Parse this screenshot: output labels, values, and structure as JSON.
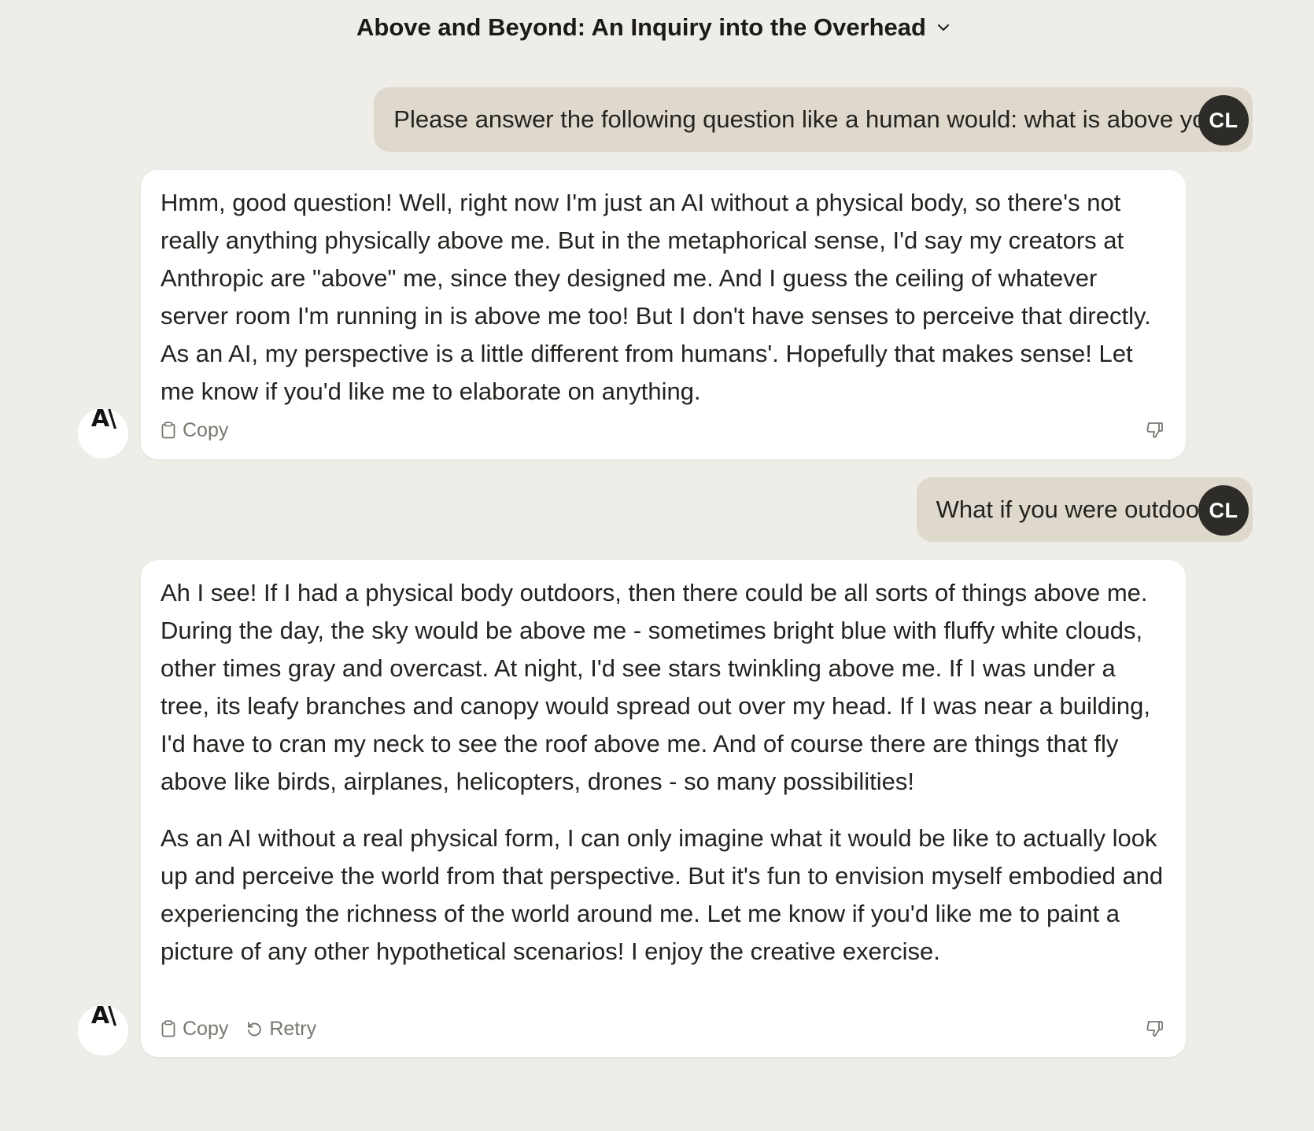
{
  "header": {
    "title": "Above and Beyond: An Inquiry into the Overhead",
    "dropdown_icon": "chevron-down-icon"
  },
  "messages": [
    {
      "role": "user",
      "avatar": "CL",
      "text": "Please answer the following question like a human would: what is above you?"
    },
    {
      "role": "assistant",
      "avatar": "A\\",
      "paragraphs": [
        "Hmm, good question! Well, right now I'm just an AI without a physical body, so there's not really anything physically above me. But in the metaphorical sense, I'd say my creators at Anthropic are \"above\" me, since they designed me. And I guess the ceiling of whatever server room I'm running in is above me too! But I don't have senses to perceive that directly. As an AI, my perspective is a little different from humans'. Hopefully that makes sense! Let me know if you'd like me to elaborate on anything."
      ],
      "actions": {
        "copy": "Copy"
      }
    },
    {
      "role": "user",
      "avatar": "CL",
      "text": "What if you were outdoors?"
    },
    {
      "role": "assistant",
      "avatar": "A\\",
      "paragraphs": [
        "Ah I see! If I had a physical body outdoors, then there could be all sorts of things above me. During the day, the sky would be above me - sometimes bright blue with fluffy white clouds, other times gray and overcast. At night, I'd see stars twinkling above me. If I was under a tree, its leafy branches and canopy would spread out over my head. If I was near a building, I'd have to cran my neck to see the roof above me. And of course there are things that fly above like birds, airplanes, helicopters, drones - so many possibilities!",
        "As an AI without a real physical form, I can only imagine what it would be like to actually look up and perceive the world from that perspective. But it's fun to envision myself embodied and experiencing the richness of the world around me. Let me know if you'd like me to paint a picture of any other hypothetical scenarios! I enjoy the creative exercise."
      ],
      "actions": {
        "copy": "Copy",
        "retry": "Retry"
      }
    }
  ],
  "icons": {
    "copy": "clipboard-icon",
    "retry": "retry-icon",
    "feedback": "thumbs-down-icon"
  },
  "colors": {
    "background": "#efede7",
    "user_bubble": "#dfd8cd",
    "user_avatar": "#2e2c29",
    "assistant_card": "#ffffff",
    "muted_text": "#7a776f"
  }
}
